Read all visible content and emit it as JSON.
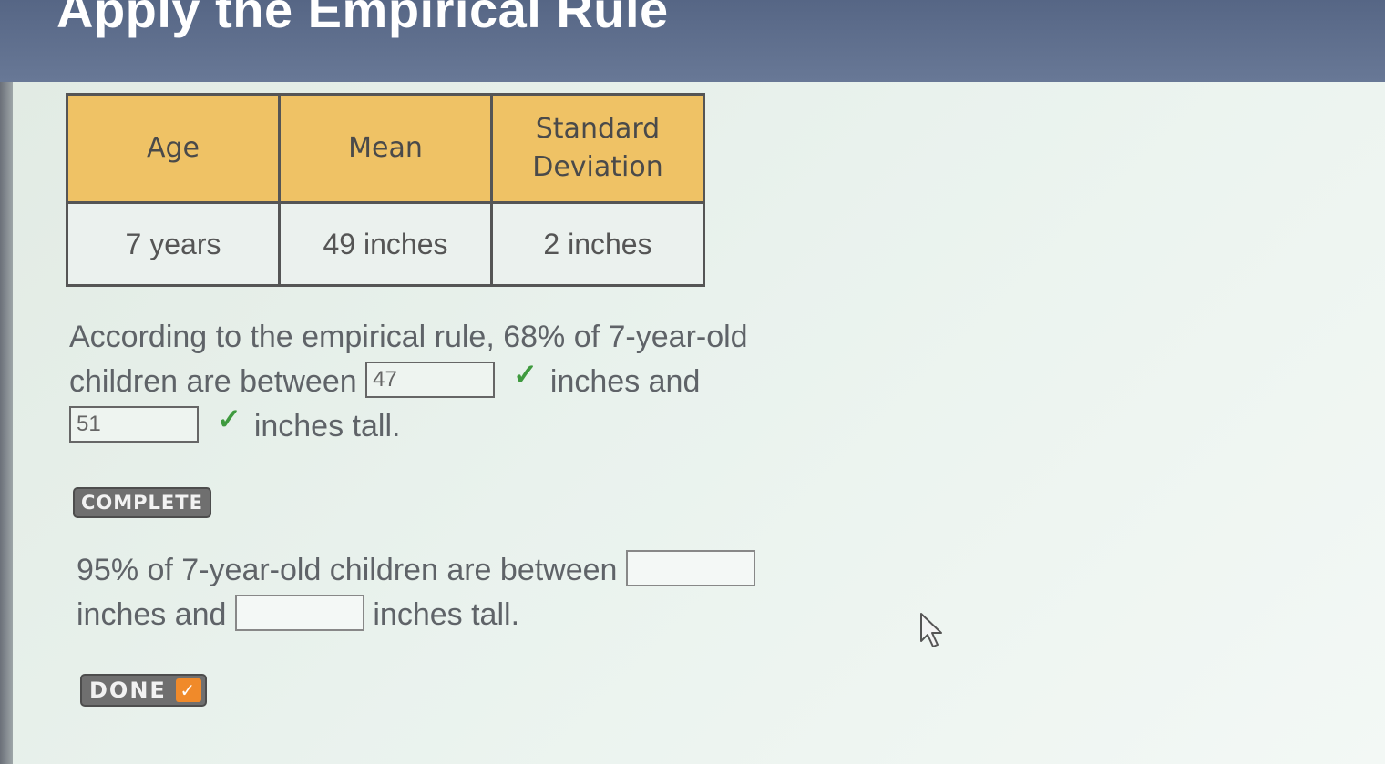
{
  "header": {
    "title": "Apply the Empirical Rule"
  },
  "table": {
    "headers": [
      "Age",
      "Mean",
      "Standard Deviation"
    ],
    "rows": [
      [
        "7 years",
        "49 inches",
        "2 inches"
      ]
    ]
  },
  "question1": {
    "text_part1": "According to the empirical rule, 68% of 7-year-old children are between",
    "input1_value": "47",
    "text_part2": "inches and",
    "input2_value": "51",
    "text_part3": "inches tall.",
    "check_symbol": "✓"
  },
  "status": {
    "complete_label": "COMPLETE"
  },
  "question2": {
    "text_part1": "95% of 7-year-old children are between",
    "input1_value": "",
    "text_part2": "inches and",
    "input2_value": "",
    "text_part3": "inches tall."
  },
  "done_button": {
    "label": "DONE",
    "check_symbol": "✓"
  },
  "colors": {
    "header_bg": "#566685",
    "table_header_bg": "#efc265",
    "done_check_bg": "#f08a2a",
    "check_green": "#3f9a3f"
  },
  "icons": {
    "cursor": "mouse-pointer-icon",
    "check": "checkmark-icon"
  }
}
